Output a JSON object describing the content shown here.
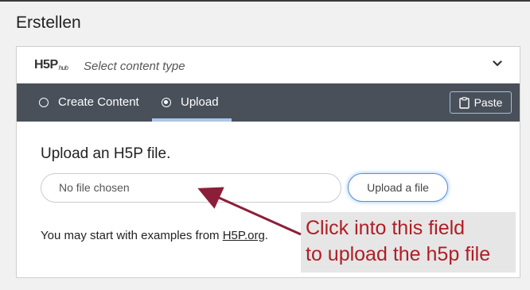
{
  "page": {
    "title": "Erstellen"
  },
  "hub": {
    "logo_text": "H5P",
    "logo_sub": "hub",
    "select_label": "Select content type"
  },
  "tabs": [
    {
      "label": "Create Content",
      "active": false
    },
    {
      "label": "Upload",
      "active": true
    }
  ],
  "paste_label": "Paste",
  "upload": {
    "heading": "Upload an H5P file.",
    "file_placeholder": "No file chosen",
    "button_label": "Upload a file"
  },
  "examples": {
    "prefix": "You may start with examples from ",
    "link_text": "H5P.org",
    "suffix": "."
  },
  "annotation": {
    "line1": "Click into this field",
    "line2": "to upload the h5p file",
    "color": "#b01e24"
  }
}
